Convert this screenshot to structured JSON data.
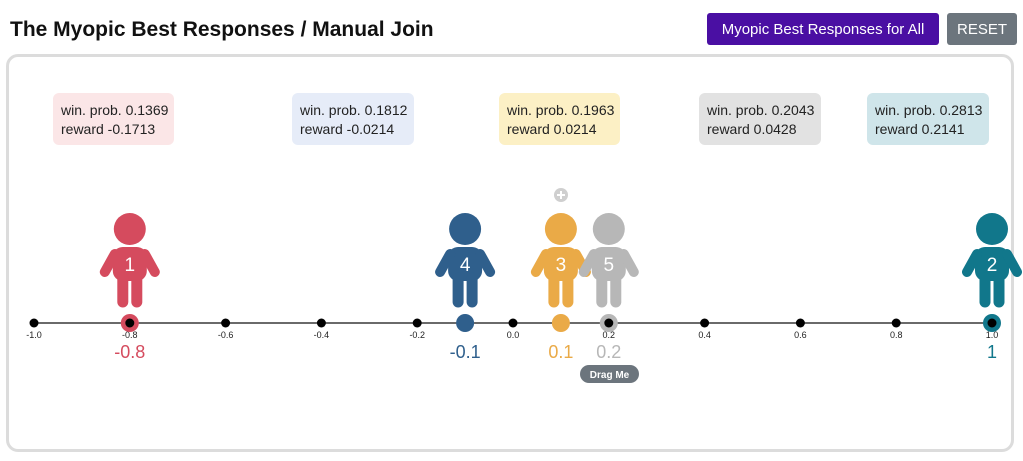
{
  "header": {
    "title": "The Myopic Best Responses / Manual Join",
    "best_button": "Myopic Best Responses for All",
    "reset_button": "RESET"
  },
  "colors": {
    "best_button": "#4a0fa3",
    "reset_button": "#6c757d",
    "p1": "#d54b5e",
    "p2": "#11778b",
    "p3": "#eaaa47",
    "p4": "#2f5f8c",
    "p5": "#b7b7b7"
  },
  "cards": [
    {
      "win": "win. prob. 0.1369",
      "reward": "reward -0.1713",
      "bg": "#fbe6e7"
    },
    {
      "win": "win. prob. 0.1812",
      "reward": "reward -0.0214",
      "bg": "#e6ecf8"
    },
    {
      "win": "win. prob. 0.1963",
      "reward": "reward 0.0214",
      "bg": "#fcf0c5"
    },
    {
      "win": "win. prob. 0.2043",
      "reward": "reward 0.0428",
      "bg": "#e2e2e2"
    },
    {
      "win": "win. prob. 0.2813",
      "reward": "reward 0.2141",
      "bg": "#cfe5ea"
    }
  ],
  "axis": {
    "ticks": [
      "-1.0",
      "-0.8",
      "-0.6",
      "-0.4",
      "-0.2",
      "0.0",
      "0.2",
      "0.4",
      "0.6",
      "0.8",
      "1.0"
    ]
  },
  "players": [
    {
      "id": "1",
      "position": -0.8,
      "label": "-0.8",
      "colorKey": "p1"
    },
    {
      "id": "4",
      "position": -0.1,
      "label": "-0.1",
      "colorKey": "p4"
    },
    {
      "id": "3",
      "position": 0.1,
      "label": "0.1",
      "colorKey": "p3"
    },
    {
      "id": "5",
      "position": 0.2,
      "label": "0.2",
      "colorKey": "p5"
    },
    {
      "id": "2",
      "position": 1.0,
      "label": "1",
      "colorKey": "p2"
    }
  ],
  "drag_label": "Drag Me",
  "add_icon": "plus-circle-icon"
}
